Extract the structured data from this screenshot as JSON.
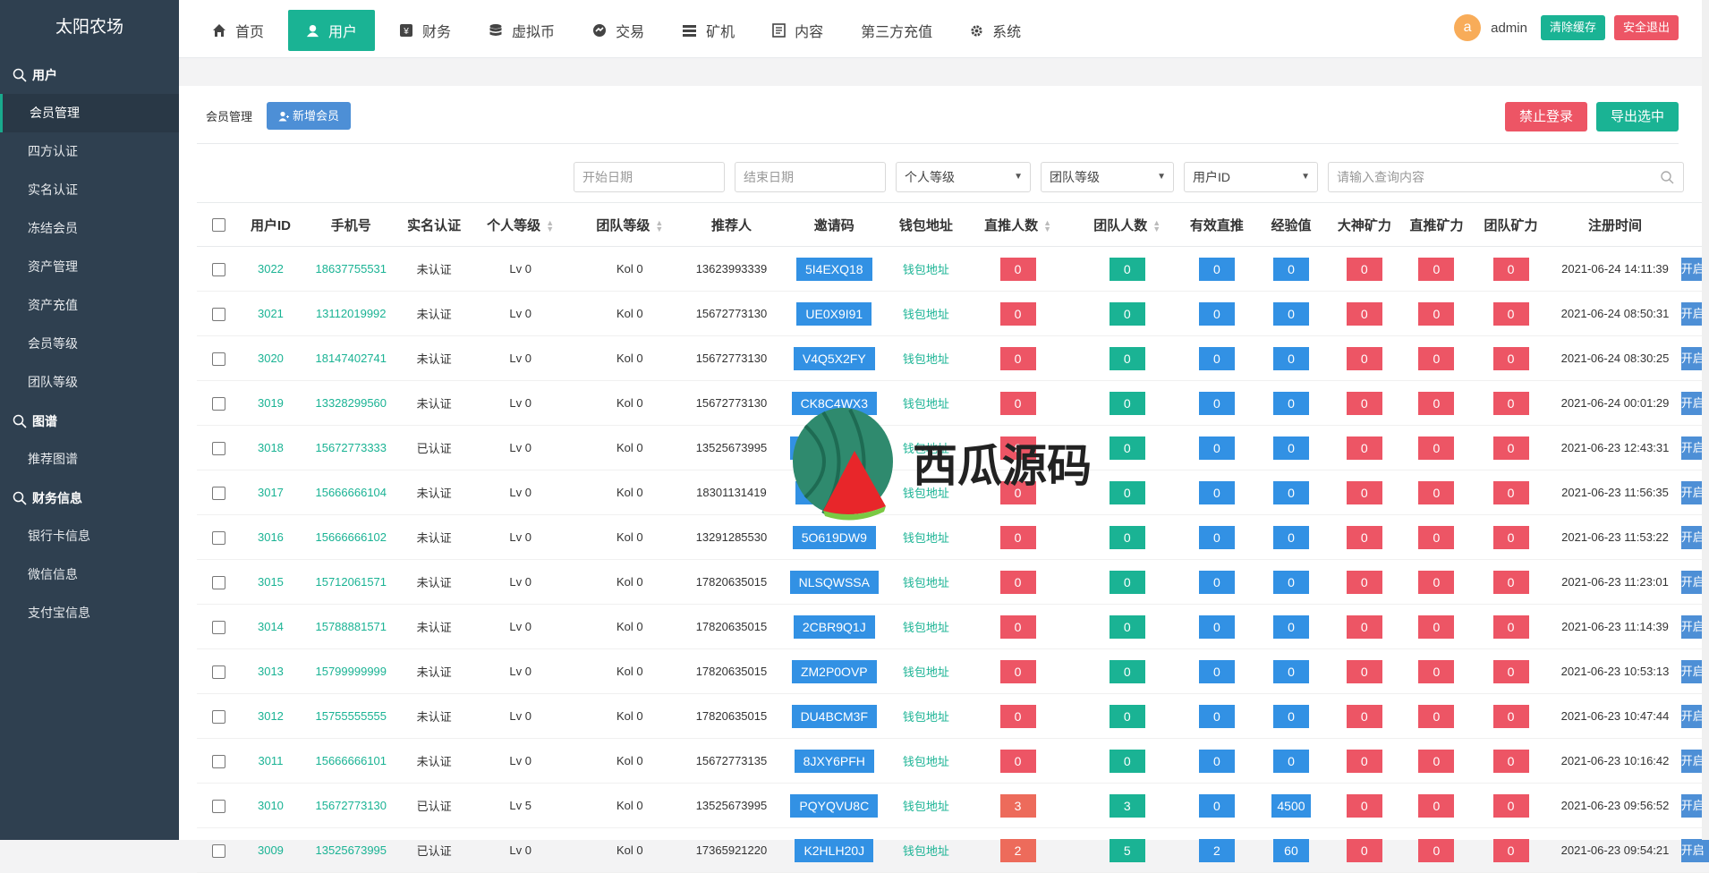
{
  "brand": "太阳农场",
  "sidebar": {
    "groups": [
      {
        "title": "用户",
        "icon": "search-icon",
        "items": [
          "会员管理",
          "四方认证",
          "实名认证",
          "冻结会员",
          "资产管理",
          "资产充值",
          "会员等级",
          "团队等级"
        ]
      },
      {
        "title": "图谱",
        "icon": "search-icon",
        "items": [
          "推荐图谱"
        ]
      },
      {
        "title": "财务信息",
        "icon": "search-icon",
        "items": [
          "银行卡信息",
          "微信信息",
          "支付宝信息"
        ]
      }
    ]
  },
  "nav": [
    {
      "label": "首页",
      "icon": "home-icon"
    },
    {
      "label": "用户",
      "icon": "user-icon"
    },
    {
      "label": "财务",
      "icon": "finance-icon"
    },
    {
      "label": "虚拟币",
      "icon": "database-icon"
    },
    {
      "label": "交易",
      "icon": "exchange-icon"
    },
    {
      "label": "矿机",
      "icon": "machine-icon"
    },
    {
      "label": "内容",
      "icon": "content-icon"
    },
    {
      "label": "第三方充值",
      "icon": ""
    },
    {
      "label": "系统",
      "icon": "gear-icon"
    }
  ],
  "topbar": {
    "avatar_letter": "a",
    "admin": "admin",
    "clear_cache": "清除缓存",
    "logout": "安全退出"
  },
  "panel": {
    "title": "会员管理",
    "add_button": "新增会员",
    "ban_login": "禁止登录",
    "export": "导出选中"
  },
  "filters": {
    "start_date": "开始日期",
    "end_date": "结束日期",
    "personal_level": "个人等级",
    "team_level": "团队等级",
    "user_id": "用户ID",
    "search_placeholder": "请输入查询内容"
  },
  "table": {
    "headers": [
      "用户ID",
      "手机号",
      "实名认证",
      "个人等级",
      "团队等级",
      "推荐人",
      "邀请码",
      "钱包地址",
      "直推人数",
      "团队人数",
      "有效直推",
      "经验值",
      "大神矿力",
      "直推矿力",
      "团队矿力",
      "注册时间",
      ""
    ],
    "wallet_label": "钱包地址",
    "action_label": "开启",
    "rows": [
      {
        "id": "3022",
        "phone": "18637755531",
        "auth": "未认证",
        "lv": "Lv 0",
        "team": "Kol 0",
        "ref": "13623993339",
        "code": "5I4EXQ18",
        "direct": "0",
        "teamn": "0",
        "valid": "0",
        "exp": "0",
        "god": "0",
        "dpow": "0",
        "tpow": "0",
        "time": "2021-06-24 14:11:39"
      },
      {
        "id": "3021",
        "phone": "13112019992",
        "auth": "未认证",
        "lv": "Lv 0",
        "team": "Kol 0",
        "ref": "15672773130",
        "code": "UE0X9I91",
        "direct": "0",
        "teamn": "0",
        "valid": "0",
        "exp": "0",
        "god": "0",
        "dpow": "0",
        "tpow": "0",
        "time": "2021-06-24 08:50:31"
      },
      {
        "id": "3020",
        "phone": "18147402741",
        "auth": "未认证",
        "lv": "Lv 0",
        "team": "Kol 0",
        "ref": "15672773130",
        "code": "V4Q5X2FY",
        "direct": "0",
        "teamn": "0",
        "valid": "0",
        "exp": "0",
        "god": "0",
        "dpow": "0",
        "tpow": "0",
        "time": "2021-06-24 08:30:25"
      },
      {
        "id": "3019",
        "phone": "13328299560",
        "auth": "未认证",
        "lv": "Lv 0",
        "team": "Kol 0",
        "ref": "15672773130",
        "code": "CK8C4WX3",
        "direct": "0",
        "teamn": "0",
        "valid": "0",
        "exp": "0",
        "god": "0",
        "dpow": "0",
        "tpow": "0",
        "time": "2021-06-24 00:01:29"
      },
      {
        "id": "3018",
        "phone": "15672773333",
        "auth": "已认证",
        "lv": "Lv 0",
        "team": "Kol 0",
        "ref": "13525673995",
        "code": "VSVS2RGM",
        "direct": "0",
        "teamn": "0",
        "valid": "0",
        "exp": "0",
        "god": "0",
        "dpow": "0",
        "tpow": "0",
        "time": "2021-06-23 12:43:31"
      },
      {
        "id": "3017",
        "phone": "15666666104",
        "auth": "未认证",
        "lv": "Lv 0",
        "team": "Kol 0",
        "ref": "18301131419",
        "code": "LS8JLPZP",
        "direct": "0",
        "teamn": "0",
        "valid": "0",
        "exp": "0",
        "god": "0",
        "dpow": "0",
        "tpow": "0",
        "time": "2021-06-23 11:56:35"
      },
      {
        "id": "3016",
        "phone": "15666666102",
        "auth": "未认证",
        "lv": "Lv 0",
        "team": "Kol 0",
        "ref": "13291285530",
        "code": "5O619DW9",
        "direct": "0",
        "teamn": "0",
        "valid": "0",
        "exp": "0",
        "god": "0",
        "dpow": "0",
        "tpow": "0",
        "time": "2021-06-23 11:53:22"
      },
      {
        "id": "3015",
        "phone": "15712061571",
        "auth": "未认证",
        "lv": "Lv 0",
        "team": "Kol 0",
        "ref": "17820635015",
        "code": "NLSQWSSA",
        "direct": "0",
        "teamn": "0",
        "valid": "0",
        "exp": "0",
        "god": "0",
        "dpow": "0",
        "tpow": "0",
        "time": "2021-06-23 11:23:01"
      },
      {
        "id": "3014",
        "phone": "15788881571",
        "auth": "未认证",
        "lv": "Lv 0",
        "team": "Kol 0",
        "ref": "17820635015",
        "code": "2CBR9Q1J",
        "direct": "0",
        "teamn": "0",
        "valid": "0",
        "exp": "0",
        "god": "0",
        "dpow": "0",
        "tpow": "0",
        "time": "2021-06-23 11:14:39"
      },
      {
        "id": "3013",
        "phone": "15799999999",
        "auth": "未认证",
        "lv": "Lv 0",
        "team": "Kol 0",
        "ref": "17820635015",
        "code": "ZM2P0OVP",
        "direct": "0",
        "teamn": "0",
        "valid": "0",
        "exp": "0",
        "god": "0",
        "dpow": "0",
        "tpow": "0",
        "time": "2021-06-23 10:53:13"
      },
      {
        "id": "3012",
        "phone": "15755555555",
        "auth": "未认证",
        "lv": "Lv 0",
        "team": "Kol 0",
        "ref": "17820635015",
        "code": "DU4BCM3F",
        "direct": "0",
        "teamn": "0",
        "valid": "0",
        "exp": "0",
        "god": "0",
        "dpow": "0",
        "tpow": "0",
        "time": "2021-06-23 10:47:44"
      },
      {
        "id": "3011",
        "phone": "15666666101",
        "auth": "未认证",
        "lv": "Lv 0",
        "team": "Kol 0",
        "ref": "15672773135",
        "code": "8JXY6PFH",
        "direct": "0",
        "teamn": "0",
        "valid": "0",
        "exp": "0",
        "god": "0",
        "dpow": "0",
        "tpow": "0",
        "time": "2021-06-23 10:16:42"
      },
      {
        "id": "3010",
        "phone": "15672773130",
        "auth": "已认证",
        "lv": "Lv 5",
        "team": "Kol 0",
        "ref": "13525673995",
        "code": "PQYQVU8C",
        "direct": "3",
        "teamn": "3",
        "valid": "0",
        "exp": "4500",
        "god": "0",
        "dpow": "0",
        "tpow": "0",
        "time": "2021-06-23 09:56:52"
      },
      {
        "id": "3009",
        "phone": "13525673995",
        "auth": "已认证",
        "lv": "Lv 0",
        "team": "Kol 0",
        "ref": "17365921220",
        "code": "K2HLH20J",
        "direct": "2",
        "teamn": "5",
        "valid": "2",
        "exp": "60",
        "god": "0",
        "dpow": "0",
        "tpow": "0",
        "time": "2021-06-23 09:54:21"
      }
    ]
  },
  "watermark": "西瓜源码",
  "colors": {
    "sidebar": "#2f4050",
    "accent": "#1ab394",
    "danger": "#ed5565",
    "primary": "#3291e4"
  }
}
